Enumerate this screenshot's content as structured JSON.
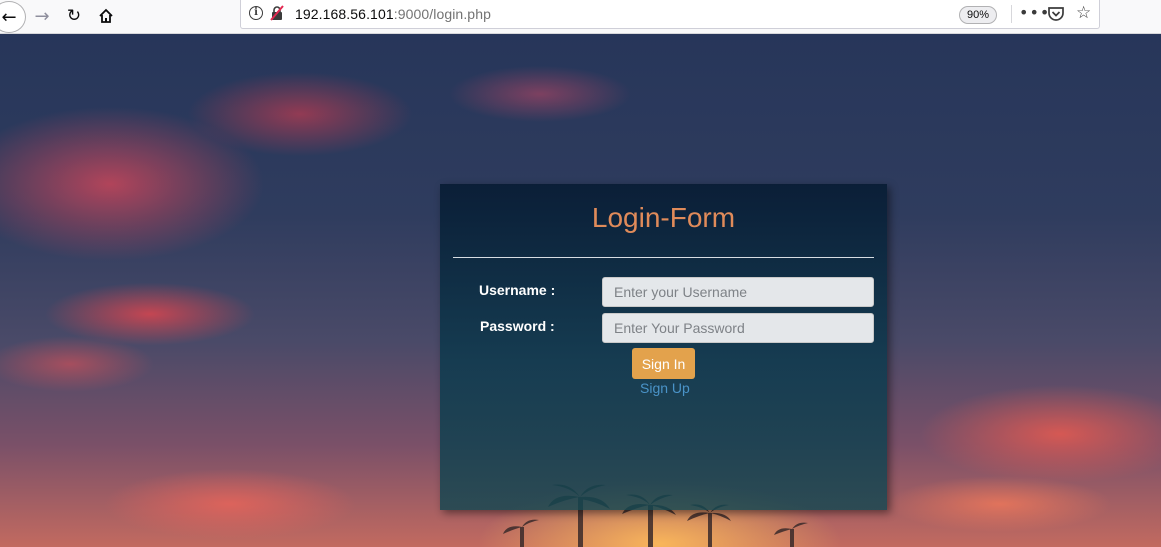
{
  "browser": {
    "url_host": "192.168.56.101",
    "url_rest": ":9000/login.php",
    "zoom": "90%",
    "icons": [
      "back-arrow-icon",
      "forward-arrow-icon",
      "reload-icon",
      "home-icon",
      "info-icon",
      "insecure-lock-icon",
      "more-dots-icon",
      "pocket-icon",
      "bookmark-star-icon"
    ]
  },
  "login": {
    "title": "Login-Form",
    "username_label": "Username :",
    "username_placeholder": "Enter your Username",
    "password_label": "Password :",
    "password_placeholder": "Enter Your Password",
    "signin_label": "Sign In",
    "signup_label": "Sign Up"
  },
  "colors": {
    "title": "#e08b5a",
    "signin_button": "#e3a24c",
    "signup_link": "#4a93c8"
  }
}
